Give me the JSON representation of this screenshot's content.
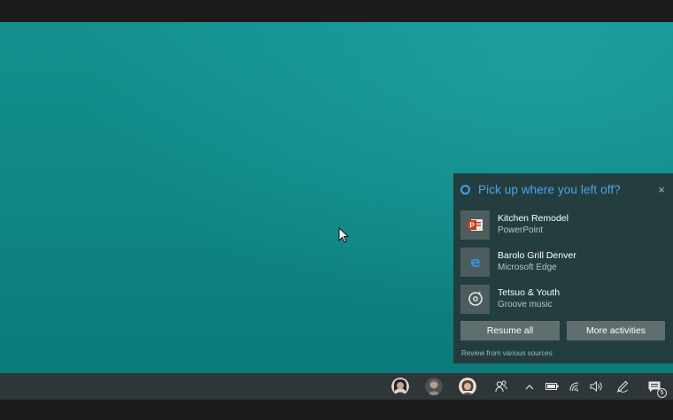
{
  "panel": {
    "title": "Pick up where you left off?",
    "close_glyph": "×",
    "activities": [
      {
        "title": "Kitchen Remodel",
        "app": "PowerPoint",
        "icon": "powerpoint-icon"
      },
      {
        "title": "Barolo Grill Denver",
        "app": "Microsoft Edge",
        "icon": "edge-icon"
      },
      {
        "title": "Tetsuo & Youth",
        "app": "Groove music",
        "icon": "groove-music-icon"
      }
    ],
    "resume_label": "Resume all",
    "more_label": "More activities",
    "footer": "Review from various sources"
  },
  "taskbar": {
    "notification_count": "5"
  },
  "colors": {
    "accent": "#4aa6e8",
    "desktop": "#11898a",
    "panel_bg": "#26383a",
    "button_bg": "#5f6e6f",
    "powerpoint": "#c43e1c"
  }
}
